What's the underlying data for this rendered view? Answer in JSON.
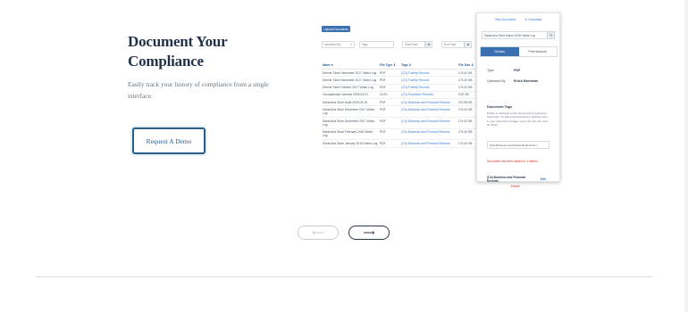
{
  "hero": {
    "title": "Document Your Compliance",
    "subtitle": "Easily track your history of compliance from a single interface.",
    "cta_label": "Request A Demo"
  },
  "app": {
    "upload_label": "Upload Documents",
    "filters": {
      "uploaded_by": "Uploaded By",
      "tags": "Tags",
      "start_date": "Start Date",
      "end_date": "End Date"
    },
    "table": {
      "headers": [
        "Name ▾",
        "File Type ⇕",
        "Tags ⇕",
        "File Size ⇕"
      ],
      "rows": [
        {
          "name": "Denver Store December 2017 Visitor Log",
          "type": "PDF",
          "tags": "(CO) Facility Records",
          "size": "174.42 KB"
        },
        {
          "name": "Denver Store November 2017 Visitor Log",
          "type": "PDF",
          "tags": "(CO) Facility Records",
          "size": "174.42 KB"
        },
        {
          "name": "Denver Store October 2017 Visitor Log",
          "type": "PDF",
          "tags": "(CO) Facility Records",
          "size": "174.42 KB"
        },
        {
          "name": "Occupational Licenses 2018-04-01",
          "type": "XLSX",
          "tags": "(CO) Employee Records",
          "size": "9.87 KB"
        },
        {
          "name": "Santa Ana Store Audit 2018-03-15",
          "type": "PDF",
          "tags": "(CA) Business and Financial Records",
          "size": "210.38 KB"
        },
        {
          "name": "Santa Ana Store December 2017 Visitor Log",
          "type": "PDF",
          "tags": "(CA) Business and Financial Records",
          "size": "174.42 KB"
        },
        {
          "name": "Santa Ana Store December 2017 Visitor Log",
          "type": "PDF",
          "tags": "(CA) Business and Financial Records",
          "size": "174.42 KB"
        },
        {
          "name": "Santa Ana Store February 2018 Visitor Log",
          "type": "PDF",
          "tags": "(CA) Business and Financial Records",
          "size": "174.42 KB"
        },
        {
          "name": "Santa Ana Store January 2018 Visitor Log",
          "type": "PDF",
          "tags": "(CA) Business and Financial Records",
          "size": "174.42 KB"
        }
      ]
    }
  },
  "detail": {
    "view_label": "View Document",
    "download_label": "Download",
    "file_name": "Santa Ana Store March 2018 Visitor Log",
    "tab_details": "Details",
    "tab_permissions": "Permissions",
    "type_label": "Type",
    "type_value": "PDF",
    "uploaded_label": "Uploaded By",
    "uploaded_value": "Erlich Bachman",
    "tags_heading": "Document Tags",
    "tags_help": "Delete or add tags to the document by typing the below box. To add a tag that doesn't already exist in your document storage, type it into the box and hit 'Enter'.",
    "tag_input": "(CA) Business and Financial Records ×",
    "warning": "Document has been added to 1 folders",
    "tag_line": "(CA) Business and Financial Records",
    "tag_edit": "Edit",
    "remove_label": "Delete"
  },
  "slider": {
    "prev_symbol": "⟵",
    "next_symbol": "⟶"
  }
}
